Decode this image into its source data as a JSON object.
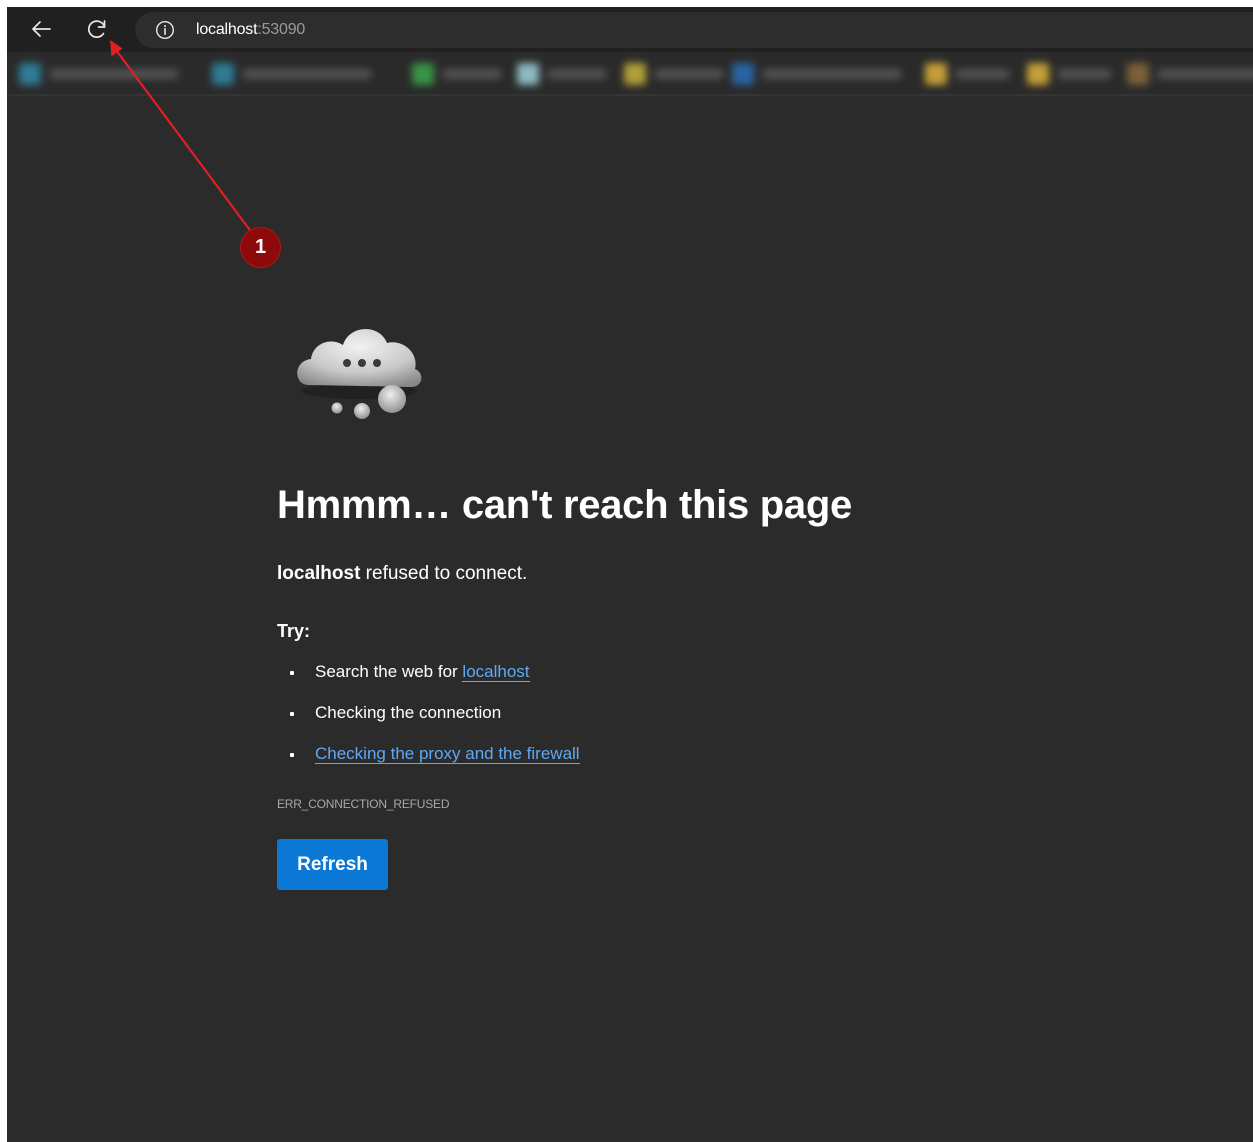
{
  "browser": {
    "back_icon": "arrow-left-icon",
    "reload_icon": "refresh-icon",
    "site_info_icon": "info-circle-icon",
    "url_host": "localhost",
    "url_port": ":53090"
  },
  "error_page": {
    "title": "Hmmm… can't reach this page",
    "subtitle_host": "localhost",
    "subtitle_rest": " refused to connect.",
    "try_label": "Try:",
    "suggestions": {
      "search_prefix": "Search the web for ",
      "search_link": "localhost",
      "connection": "Checking the connection",
      "proxy_link": "Checking the proxy and the firewall"
    },
    "error_code": "ERR_CONNECTION_REFUSED",
    "refresh_label": "Refresh"
  },
  "annotation": {
    "marker_number": "1",
    "marker_color": "#8e0a0a",
    "arrow_color": "#e02020"
  },
  "colors": {
    "page_background": "#2b2b2b",
    "toolbar_background": "#202020",
    "link": "#5ea9f5",
    "button": "#0a78d4"
  }
}
